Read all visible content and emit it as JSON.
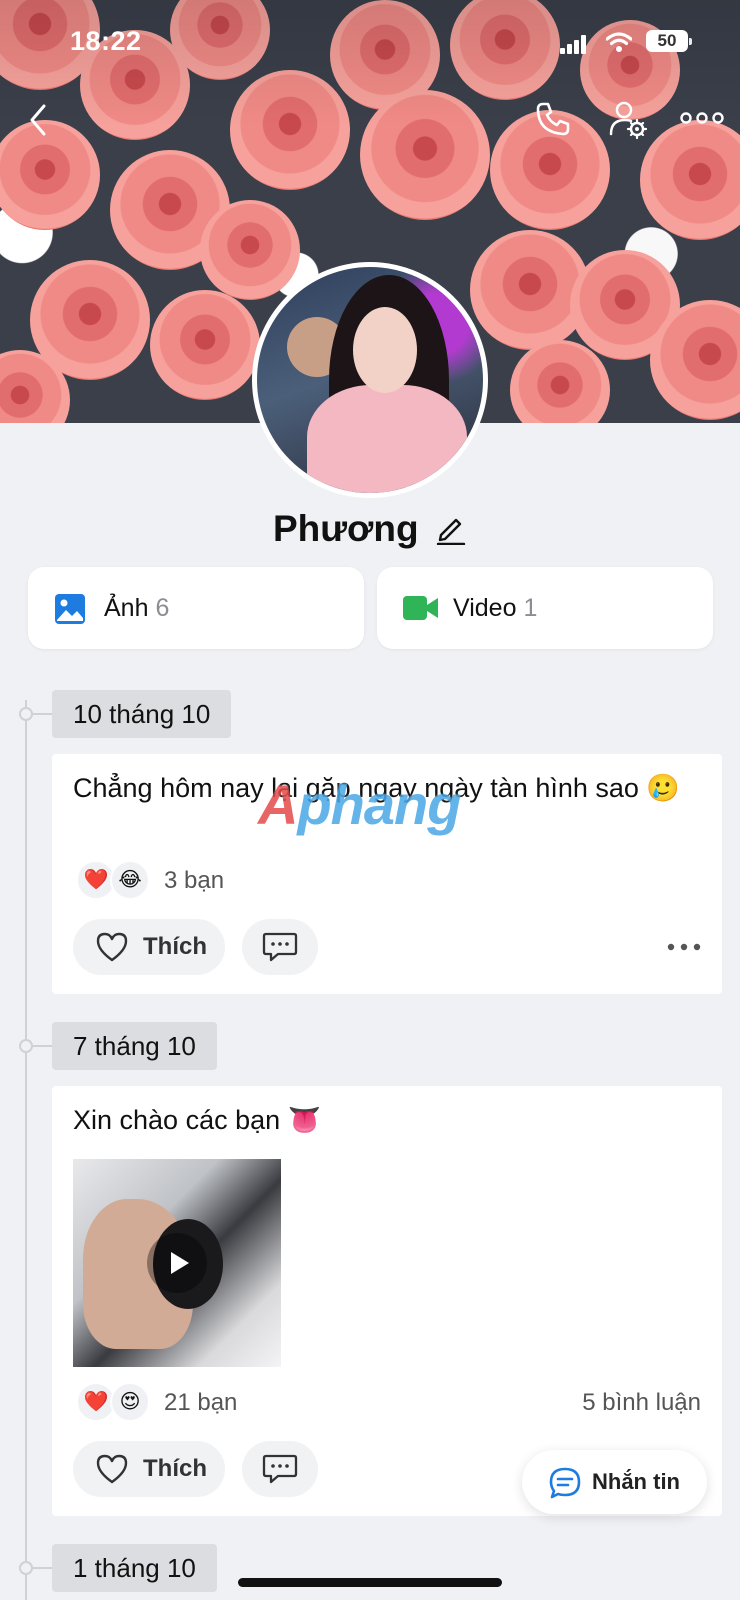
{
  "status_bar": {
    "time": "18:22",
    "battery": "50"
  },
  "profile": {
    "name": "Phương"
  },
  "media": {
    "photos": {
      "label": "Ảnh",
      "count": "6"
    },
    "videos": {
      "label": "Video",
      "count": "1"
    }
  },
  "watermark": {
    "part1": "A",
    "part2": "phang"
  },
  "posts": [
    {
      "date": "10 tháng 10",
      "text": "Chẳng hôm nay lại gặp ngay ngày tàn hình sao 🥲",
      "reactions": [
        "❤️",
        "😂"
      ],
      "reaction_count": "3 bạn",
      "like_label": "Thích"
    },
    {
      "date": "7 tháng 10",
      "text": "Xin chào các bạn 👅",
      "reactions": [
        "❤️",
        "😍"
      ],
      "reaction_count": "21 bạn",
      "comment_count": "5 bình luận",
      "like_label": "Thích"
    },
    {
      "date": "1 tháng 10"
    }
  ],
  "chat_button": {
    "label": "Nhắn tin"
  },
  "colors": {
    "accent_blue": "#1e7be0",
    "video_green": "#2fb457",
    "background": "#f0f1f4"
  }
}
